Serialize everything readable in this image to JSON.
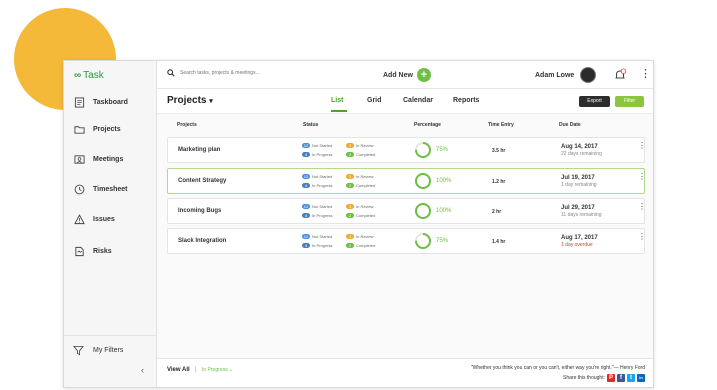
{
  "brand": {
    "name": "Task",
    "color": "#2c9a3f"
  },
  "sidebar": {
    "items": [
      {
        "label": "Taskboard",
        "icon": "taskboard-icon"
      },
      {
        "label": "Projects",
        "icon": "folder-icon"
      },
      {
        "label": "Meetings",
        "icon": "meetings-icon"
      },
      {
        "label": "Timesheet",
        "icon": "clock-icon"
      },
      {
        "label": "Issues",
        "icon": "warning-icon"
      },
      {
        "label": "Risks",
        "icon": "risk-icon"
      }
    ],
    "filters_label": "My Filters",
    "collapse_glyph": "‹"
  },
  "topbar": {
    "search_placeholder": "Search tasks, projects & meetings...",
    "add_new_label": "Add New",
    "user_name": "Adam Lowe",
    "menu_glyph": "⋮"
  },
  "subheader": {
    "title": "Projects",
    "tabs": [
      "List",
      "Grid",
      "Calendar",
      "Reports"
    ],
    "active_tab": "List",
    "export_label": "Export",
    "filter_label": "Filter"
  },
  "table": {
    "headers": [
      "Projects",
      "Status",
      "Percentage",
      "Time Entry",
      "Due Date"
    ],
    "status_labels": {
      "not_started": "Not Started",
      "in_progress": "In Progress",
      "in_review": "In Review",
      "completed": "Completed"
    },
    "rows": [
      {
        "name": "Marketing plan",
        "counts": {
          "not_started": "12",
          "in_progress": "4",
          "in_review": "3",
          "completed": "2"
        },
        "percent_label": "75%",
        "percent": 0.75,
        "time": "3.5 hr",
        "due": "Aug 14, 2017",
        "remaining": "22 days remaining",
        "overdue": false
      },
      {
        "name": "Content Strategy",
        "counts": {
          "not_started": "12",
          "in_progress": "4",
          "in_review": "3",
          "completed": "2"
        },
        "percent_label": "100%",
        "percent": 1.0,
        "time": "1.2 hr",
        "due": "Jul 19, 2017",
        "remaining": "1 day remaining",
        "overdue": false
      },
      {
        "name": "Incoming Bugs",
        "counts": {
          "not_started": "12",
          "in_progress": "4",
          "in_review": "3",
          "completed": "2"
        },
        "percent_label": "100%",
        "percent": 1.0,
        "time": "2 hr",
        "due": "Jul 29, 2017",
        "remaining": "11 days remaining",
        "overdue": false
      },
      {
        "name": "Slack Integration",
        "counts": {
          "not_started": "12",
          "in_progress": "4",
          "in_review": "3",
          "completed": "2"
        },
        "percent_label": "75%",
        "percent": 0.75,
        "time": "1.4 hr",
        "due": "Aug 17, 2017",
        "remaining": "1 day overdue",
        "overdue": true
      }
    ]
  },
  "footer": {
    "view_all_label": "View All",
    "separator": "|",
    "filter_label": "In Progress",
    "filter_caret": "⌄",
    "quote": "\"Whether you think you can or you can't, either way you're right.\"— Henry Ford",
    "share_label": "Share this thought:",
    "social": [
      {
        "name": "pinterest-icon",
        "glyph": "P",
        "color": "#e02a2a"
      },
      {
        "name": "facebook-icon",
        "glyph": "f",
        "color": "#3b5998"
      },
      {
        "name": "twitter-icon",
        "glyph": "t",
        "color": "#1da1f2"
      },
      {
        "name": "linkedin-icon",
        "glyph": "in",
        "color": "#0a66c2"
      }
    ]
  },
  "colors": {
    "accent_green": "#6cbf42",
    "tab_active": "#4aa32b",
    "overdue_red": "#e53935",
    "backdrop_circle": "#f5b93a"
  }
}
